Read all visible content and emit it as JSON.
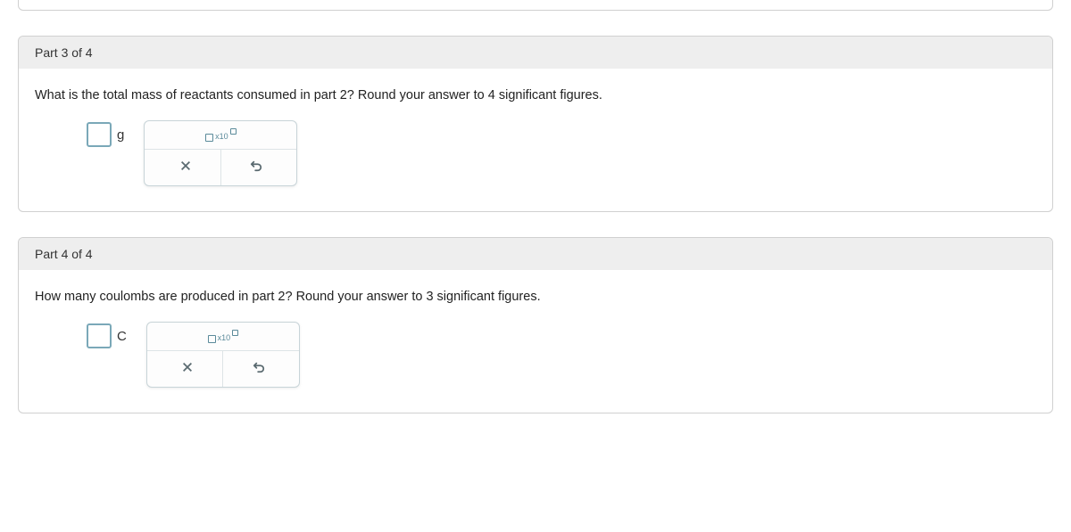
{
  "parts": {
    "part3": {
      "header": "Part 3 of 4",
      "question": "What is the total mass of reactants consumed in part 2? Round your answer to 4 significant figures.",
      "unit": "g",
      "value": "",
      "sci_label": "x10"
    },
    "part4": {
      "header": "Part 4 of 4",
      "question": "How many coulombs are produced in part 2? Round your answer to 3 significant figures.",
      "unit": "C",
      "value": "",
      "sci_label": "x10"
    }
  }
}
